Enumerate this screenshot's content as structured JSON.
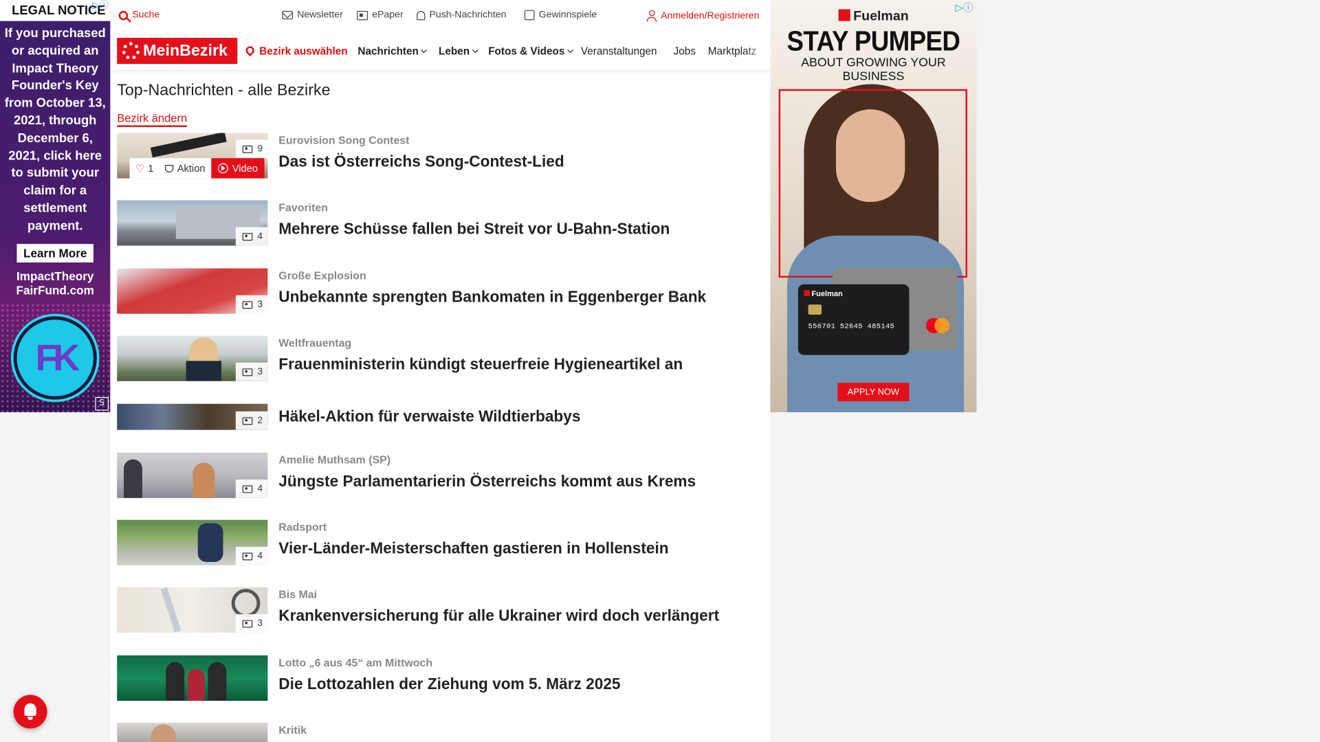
{
  "left_ad": {
    "legal": "LEGAL NOTICE",
    "body": "If you purchased or acquired an Impact Theory Founder's Key from October 13, 2021, through December 6, 2021, click here to submit your claim for a settlement payment.",
    "learn_more": "Learn More",
    "site": "ImpactTheory FairFund.com",
    "logo_text": "FK"
  },
  "topbar": {
    "search": "Suche",
    "newsletter": "Newsletter",
    "epaper": "ePaper",
    "push": "Push-Nachrichten",
    "games": "Gewinnspiele",
    "login": "Anmelden/Registrieren"
  },
  "nav": {
    "brand": "MeinBezirk",
    "district": "Bezirk auswählen",
    "items": [
      "Nachrichten",
      "Leben",
      "Fotos & Videos",
      "Veranstaltungen",
      "Jobs",
      "Marktplatz"
    ]
  },
  "page": {
    "title": "Top-Nachrichten - alle Bezirke",
    "change_district": "Bezirk ändern"
  },
  "articles": [
    {
      "kicker": "Eurovision Song Contest",
      "title": "Das ist Österreichs Song-Contest-Lied",
      "count": "9",
      "likes": "1",
      "action": "Aktion",
      "video": "Video"
    },
    {
      "kicker": "Favoriten",
      "title": "Mehrere Schüsse fallen bei Streit vor U-Bahn-Station",
      "count": "4"
    },
    {
      "kicker": "Große Explosion",
      "title": "Unbekannte sprengten Bankomaten in Eggenberger Bank",
      "count": "3"
    },
    {
      "kicker": "Weltfrauentag",
      "title": "Frauenministerin kündigt steuerfreie Hygieneartikel an",
      "count": "3"
    },
    {
      "kicker": "",
      "title": "Häkel-Aktion für verwaiste Wildtierbabys",
      "count": "2"
    },
    {
      "kicker": "Amelie Muthsam (SP)",
      "title": "Jüngste Parlamentarierin Österreichs kommt aus Krems",
      "count": "4"
    },
    {
      "kicker": "Radsport",
      "title": "Vier-Länder-Meisterschaften gastieren in Hollenstein",
      "count": "4"
    },
    {
      "kicker": "Bis Mai",
      "title": "Krankenversicherung für alle Ukrainer wird doch verlängert",
      "count": "3"
    },
    {
      "kicker": "Lotto „6 aus 45“ am Mittwoch",
      "title": "Die Lottozahlen der Ziehung vom 5. März 2025",
      "count": ""
    },
    {
      "kicker": "Kritik",
      "title": "",
      "count": ""
    }
  ],
  "right_ad": {
    "brand": "Fuelman",
    "headline": "STAY PUMPED",
    "sub": "ABOUT GROWING YOUR BUSINESS",
    "card_brand": "Fuelman",
    "card_number": "556701 52645 485145",
    "apply": "APPLY NOW"
  },
  "colors": {
    "brand_red": "#e3101a",
    "accent_blue": "#2a9bd8"
  }
}
